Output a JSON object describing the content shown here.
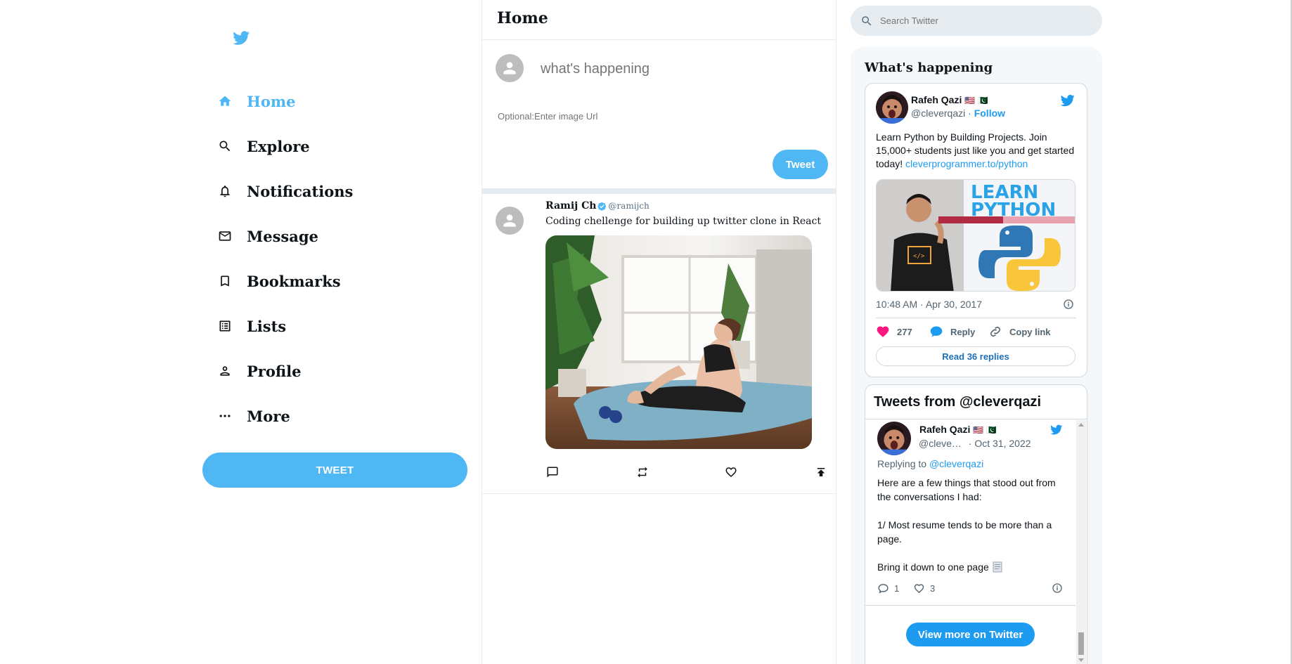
{
  "sidebar": {
    "items": [
      {
        "label": "Home",
        "icon": "home-icon",
        "active": true
      },
      {
        "label": "Explore",
        "icon": "search-icon"
      },
      {
        "label": "Notifications",
        "icon": "bell-icon"
      },
      {
        "label": "Message",
        "icon": "mail-icon"
      },
      {
        "label": "Bookmarks",
        "icon": "bookmark-icon"
      },
      {
        "label": "Lists",
        "icon": "list-icon"
      },
      {
        "label": "Profile",
        "icon": "person-icon"
      },
      {
        "label": "More",
        "icon": "more-icon"
      }
    ],
    "tweet_button": "TWEET"
  },
  "feed": {
    "title": "Home",
    "compose": {
      "placeholder": "what's happening",
      "image_placeholder": "Optional:Enter image Url",
      "button": "Tweet"
    },
    "post": {
      "display_name": "Ramij Ch",
      "handle": "@ramijch",
      "text": "Coding chellenge for building up twitter clone in React",
      "image_alt": "Woman stretching on a yoga mat"
    }
  },
  "search": {
    "placeholder": "Search Twitter"
  },
  "widgets": {
    "title": "What's happening",
    "embed": {
      "name": "Rafeh Qazi",
      "flags": "🇺🇸 🇵🇰",
      "handle": "@cleverqazi",
      "separator": "·",
      "follow": "Follow",
      "text": "Learn Python by Building Projects. Join 15,000+ students just like you and get started today!",
      "link": "cleverprogrammer.to/python",
      "media_text_1": "LEARN",
      "media_text_2": "PYTHON",
      "timestamp": "10:48 AM · Apr 30, 2017",
      "likes": "277",
      "reply": "Reply",
      "copy_link": "Copy link",
      "read_replies": "Read 36 replies"
    },
    "timeline": {
      "title": "Tweets from @cleverqazi",
      "name": "Rafeh Qazi",
      "flags": "🇺🇸 🇵🇰",
      "handle": "@cleve…",
      "date": "· Oct 31, 2022",
      "replying_prefix": "Replying to",
      "replying_to": "@cleverqazi",
      "line1": "Here are a few things that stood out from the conversations I had:",
      "line2": "1/ Most resume tends to be more than a page.",
      "line3": "Bring it down to one page",
      "replies": "1",
      "likes": "3",
      "view_more": "View more on Twitter"
    }
  },
  "colors": {
    "accent": "#50b7f5",
    "twitter_blue": "#1d9bf0",
    "heart": "#f91880",
    "border": "#e6ecf0"
  }
}
